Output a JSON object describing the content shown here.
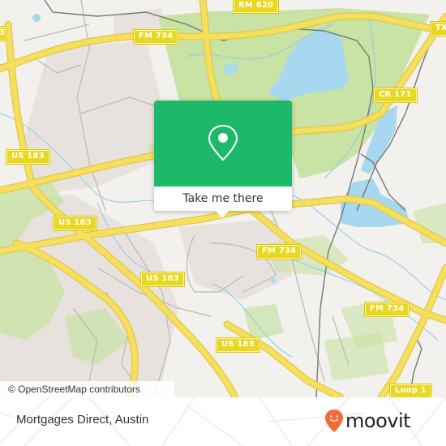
{
  "map": {
    "attribution": "© OpenStreetMap contributors",
    "colors": {
      "background": "#f2f1ee",
      "park": "#c8e3a4",
      "water": "#a8d8ef",
      "highway": "#f6df5c",
      "shield": "#e8d81f",
      "railway": "#777777",
      "urban": "#e6e0dd"
    },
    "road_labels": [
      {
        "id": "rm-620",
        "text": "RM 620"
      },
      {
        "id": "fm-734-north",
        "text": "FM 734"
      },
      {
        "id": "tx-edge",
        "text": "TX"
      },
      {
        "id": "cr-171",
        "text": "CR 171"
      },
      {
        "id": "us-183-west",
        "text": "US 183"
      },
      {
        "id": "us-183-southwest",
        "text": "US 183"
      },
      {
        "id": "fm-734-center",
        "text": "FM 734"
      },
      {
        "id": "us-183-center",
        "text": "US 183"
      },
      {
        "id": "fm-734-east",
        "text": "FM 734"
      },
      {
        "id": "us-183-south",
        "text": "US 183"
      },
      {
        "id": "loop-1",
        "text": "Loop 1"
      },
      {
        "id": "left-edge",
        "text": "3"
      }
    ]
  },
  "popup": {
    "icon": "location-pin-icon",
    "action_label": "Take me there",
    "accent": "#1eb86b"
  },
  "footer": {
    "place_name": "Mortgages Direct, Austin",
    "brand": "moovit",
    "brand_color": "#f26b3a"
  }
}
